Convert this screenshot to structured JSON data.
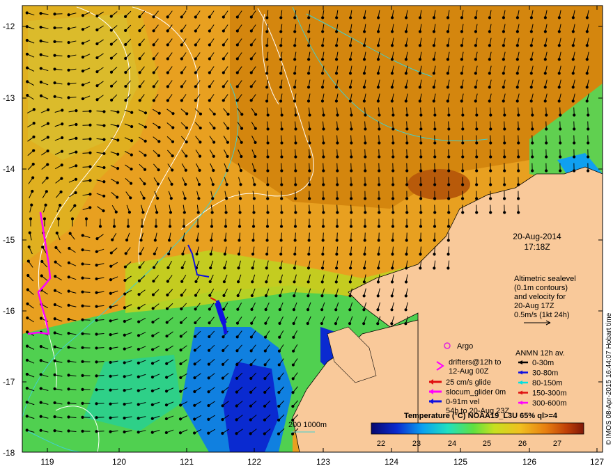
{
  "map": {
    "date": "20-Aug-2014",
    "time": "17:18Z",
    "credit": "© IMOS 08-Apr-2015 16:44:07 Hobart time",
    "lon_ticks": [
      "119",
      "120",
      "121",
      "122",
      "123",
      "124",
      "125",
      "126",
      "127"
    ],
    "lat_ticks": [
      "-12",
      "-13",
      "-14",
      "-15",
      "-16",
      "-17",
      "-18"
    ],
    "altimetry_note": [
      "Altimetric sealevel",
      "(0.1m contours)",
      "and velocity for",
      "20-Aug 17Z",
      "0.5m/s (1kt 24h)"
    ],
    "bathy_label": "200  1000m",
    "colorbar": {
      "title": "Temperature (°C) NOAA19_L3U 65% ql>=4",
      "ticks": [
        "22",
        "23",
        "24",
        "25",
        "26",
        "27"
      ],
      "stops": [
        "#08086e",
        "#0a2ad0",
        "#0aa0f0",
        "#20e0c0",
        "#60e040",
        "#c8e020",
        "#f0c020",
        "#e88010",
        "#c04008",
        "#801808"
      ]
    },
    "legend_left": {
      "argo": "Argo",
      "drifters": [
        "drifters@12h to",
        "12-Aug 00Z"
      ],
      "glide": "25 cm/s glide",
      "slocum": "slocum_glider 0m",
      "vel": [
        "0-91m vel",
        "54h to 20-Aug 23Z"
      ]
    },
    "legend_right": {
      "title": "ANMN 12h av.",
      "items": [
        {
          "label": "0-30m",
          "color": "#000000"
        },
        {
          "label": "30-80m",
          "color": "#1010e0"
        },
        {
          "label": "80-150m",
          "color": "#00e0e0"
        },
        {
          "label": "150-300m",
          "color": "#e01010"
        },
        {
          "label": "300-600m",
          "color": "#ff00ff"
        }
      ]
    },
    "colors": {
      "land": "#f9c99a",
      "argo": "#e020e0",
      "drifter": "#ff00ff",
      "glider_red": "#e01010",
      "glider_magenta": "#ff00ff",
      "glider_blue": "#1010e0",
      "contour": "#ffffff",
      "bathy": "#40d0d0"
    }
  }
}
